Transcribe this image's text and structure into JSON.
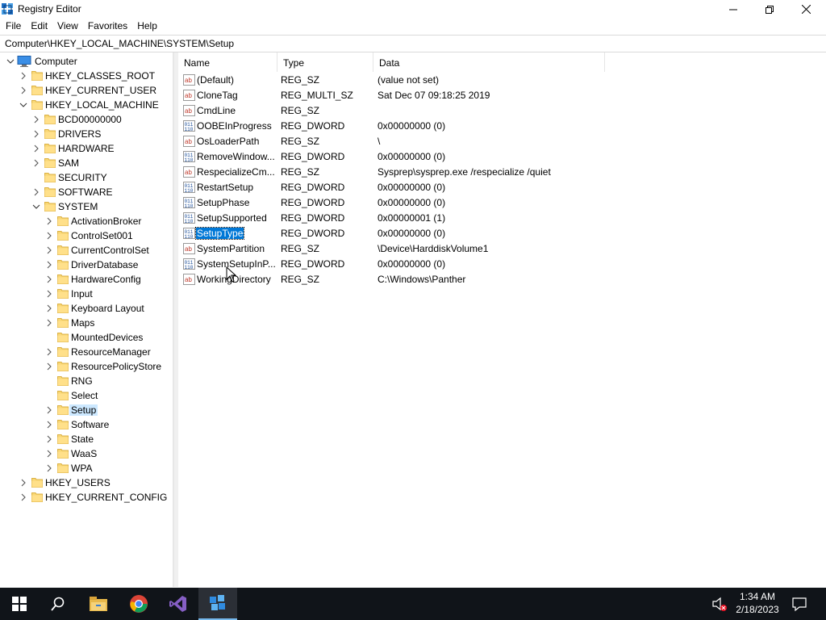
{
  "window": {
    "title": "Registry Editor",
    "menu": [
      "File",
      "Edit",
      "View",
      "Favorites",
      "Help"
    ]
  },
  "address": {
    "path": "Computer\\HKEY_LOCAL_MACHINE\\SYSTEM\\Setup"
  },
  "tree": {
    "nodes": [
      {
        "label": "Computer",
        "icon": "computer-icon",
        "expanded": true
      },
      {
        "label": "HKEY_CLASSES_ROOT",
        "icon": "folder-icon",
        "expanded": false
      },
      {
        "label": "HKEY_CURRENT_USER",
        "icon": "folder-icon",
        "expanded": false
      },
      {
        "label": "HKEY_LOCAL_MACHINE",
        "icon": "folder-icon",
        "expanded": true
      },
      {
        "label": "BCD00000000",
        "icon": "folder-icon",
        "expanded": false
      },
      {
        "label": "DRIVERS",
        "icon": "folder-icon",
        "expanded": false
      },
      {
        "label": "HARDWARE",
        "icon": "folder-icon",
        "expanded": false
      },
      {
        "label": "SAM",
        "icon": "folder-icon",
        "expanded": false
      },
      {
        "label": "SECURITY",
        "icon": "folder-icon",
        "expanded": null
      },
      {
        "label": "SOFTWARE",
        "icon": "folder-icon",
        "expanded": false
      },
      {
        "label": "SYSTEM",
        "icon": "folder-icon",
        "expanded": true
      },
      {
        "label": "ActivationBroker",
        "icon": "folder-icon",
        "expanded": false
      },
      {
        "label": "ControlSet001",
        "icon": "folder-icon",
        "expanded": false
      },
      {
        "label": "CurrentControlSet",
        "icon": "folder-icon",
        "expanded": false
      },
      {
        "label": "DriverDatabase",
        "icon": "folder-icon",
        "expanded": false
      },
      {
        "label": "HardwareConfig",
        "icon": "folder-icon",
        "expanded": false
      },
      {
        "label": "Input",
        "icon": "folder-icon",
        "expanded": false
      },
      {
        "label": "Keyboard Layout",
        "icon": "folder-icon",
        "expanded": false
      },
      {
        "label": "Maps",
        "icon": "folder-icon",
        "expanded": false
      },
      {
        "label": "MountedDevices",
        "icon": "folder-icon",
        "expanded": null
      },
      {
        "label": "ResourceManager",
        "icon": "folder-icon",
        "expanded": false
      },
      {
        "label": "ResourcePolicyStore",
        "icon": "folder-icon",
        "expanded": false
      },
      {
        "label": "RNG",
        "icon": "folder-icon",
        "expanded": null
      },
      {
        "label": "Select",
        "icon": "folder-icon",
        "expanded": null
      },
      {
        "label": "Setup",
        "icon": "folder-icon",
        "expanded": false,
        "selected": true
      },
      {
        "label": "Software",
        "icon": "folder-icon",
        "expanded": false
      },
      {
        "label": "State",
        "icon": "folder-icon",
        "expanded": false
      },
      {
        "label": "WaaS",
        "icon": "folder-icon",
        "expanded": false
      },
      {
        "label": "WPA",
        "icon": "folder-icon",
        "expanded": false
      },
      {
        "label": "HKEY_USERS",
        "icon": "folder-icon",
        "expanded": false
      },
      {
        "label": "HKEY_CURRENT_CONFIG",
        "icon": "folder-icon",
        "expanded": false
      }
    ]
  },
  "list": {
    "columns": [
      "Name",
      "Type",
      "Data"
    ],
    "rows": [
      {
        "name": "(Default)",
        "type": "REG_SZ",
        "data": "(value not set)",
        "icon": "string-value-icon"
      },
      {
        "name": "CloneTag",
        "type": "REG_MULTI_SZ",
        "data": "Sat Dec 07 09:18:25 2019",
        "icon": "string-value-icon"
      },
      {
        "name": "CmdLine",
        "type": "REG_SZ",
        "data": "",
        "icon": "string-value-icon"
      },
      {
        "name": "OOBEInProgress",
        "type": "REG_DWORD",
        "data": "0x00000000 (0)",
        "icon": "binary-value-icon"
      },
      {
        "name": "OsLoaderPath",
        "type": "REG_SZ",
        "data": "\\",
        "icon": "string-value-icon"
      },
      {
        "name": "RemoveWindow...",
        "type": "REG_DWORD",
        "data": "0x00000000 (0)",
        "icon": "binary-value-icon"
      },
      {
        "name": "RespecializeCm...",
        "type": "REG_SZ",
        "data": "Sysprep\\sysprep.exe /respecialize /quiet",
        "icon": "string-value-icon"
      },
      {
        "name": "RestartSetup",
        "type": "REG_DWORD",
        "data": "0x00000000 (0)",
        "icon": "binary-value-icon"
      },
      {
        "name": "SetupPhase",
        "type": "REG_DWORD",
        "data": "0x00000000 (0)",
        "icon": "binary-value-icon"
      },
      {
        "name": "SetupSupported",
        "type": "REG_DWORD",
        "data": "0x00000001 (1)",
        "icon": "binary-value-icon"
      },
      {
        "name": "SetupType",
        "type": "REG_DWORD",
        "data": "0x00000000 (0)",
        "icon": "binary-value-icon",
        "selected": true
      },
      {
        "name": "SystemPartition",
        "type": "REG_SZ",
        "data": "\\Device\\HarddiskVolume1",
        "icon": "string-value-icon"
      },
      {
        "name": "SystemSetupInP...",
        "type": "REG_DWORD",
        "data": "0x00000000 (0)",
        "icon": "binary-value-icon"
      },
      {
        "name": "WorkingDirectory",
        "type": "REG_SZ",
        "data": "C:\\Windows\\Panther",
        "icon": "string-value-icon"
      }
    ]
  },
  "taskbar": {
    "apps": [
      "start-icon",
      "search-icon",
      "file-explorer-icon",
      "chrome-icon",
      "visual-studio-icon",
      "registry-editor-icon"
    ],
    "time": "1:34 AM",
    "date": "2/18/2023"
  },
  "colors": {
    "selection": "#0078d7",
    "tree_selection": "#cce8ff",
    "taskbar": "#101419"
  }
}
